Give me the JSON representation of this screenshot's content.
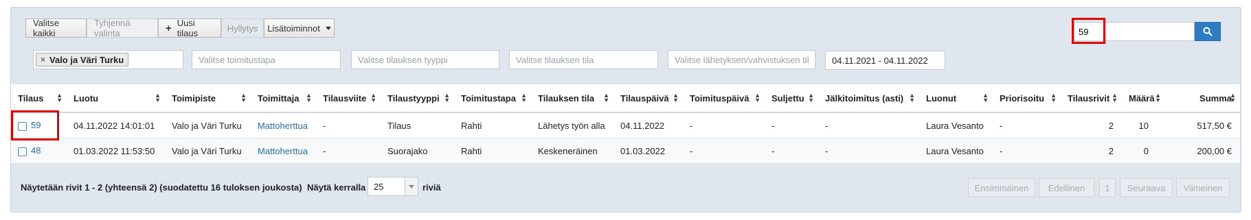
{
  "toolbar": {
    "select_all": "Valitse kaikki",
    "clear_selection": "Tyhjennä valinta",
    "new_order_icon": "plus-icon",
    "new_order": "Uusi tilaus",
    "approval": "Hyllytys",
    "more_actions": "Lisätoiminnot"
  },
  "search": {
    "value": "59",
    "icon": "search-icon"
  },
  "filters": {
    "store_tag": "Valo ja Väri Turku",
    "delivery_method_placeholder": "Valitse toimitustapa",
    "order_type_placeholder": "Valitse tilauksen tyyppi",
    "order_status_placeholder": "Valitse tilauksen tila",
    "shipment_status_placeholder": "Valitse lähetyksen/vahvistuksen tila",
    "date_range": "04.11.2021 - 04.11.2022"
  },
  "table": {
    "columns": [
      "Tilaus",
      "Luotu",
      "Toimipiste",
      "Toimittaja",
      "Tilausviite",
      "Tilaustyyppi",
      "Toimitustapa",
      "Tilauksen tila",
      "Tilauspäivä",
      "Toimituspäivä",
      "Suljettu",
      "Jälkitoimitus (asti)",
      "Luonut",
      "Priorisoitu",
      "Tilausrivit",
      "Määrä",
      "Summa"
    ],
    "rows": [
      {
        "order": "59",
        "created": "04.11.2022 14:01:01",
        "store": "Valo ja Väri Turku",
        "supplier": "Mattoherttua",
        "reference": "-",
        "type": "Tilaus",
        "delivery": "Rahti",
        "status": "Lähetys työn alla",
        "order_date": "04.11.2022",
        "delivery_date": "-",
        "closed": "-",
        "backorder": "-",
        "created_by": "Laura Vesanto",
        "prioritized": "-",
        "lines": "2",
        "quantity": "10",
        "sum": "517,50 €"
      },
      {
        "order": "48",
        "created": "01.03.2022 11:53:50",
        "store": "Valo ja Väri Turku",
        "supplier": "Mattoherttua",
        "reference": "-",
        "type": "Suorajako",
        "delivery": "Rahti",
        "status": "Keskeneräinen",
        "order_date": "01.03.2022",
        "delivery_date": "-",
        "closed": "-",
        "backorder": "-",
        "created_by": "Laura Vesanto",
        "prioritized": "-",
        "lines": "2",
        "quantity": "0",
        "sum": "200,00 €"
      }
    ]
  },
  "footer": {
    "summary": "Näytetään rivit 1 - 2 (yhteensä 2) (suodatettu 16 tuloksen joukosta)",
    "show_label": "Näytä kerralla",
    "page_size": "25",
    "rows_label": "riviä"
  },
  "pagination": {
    "first": "Ensimmäinen",
    "previous": "Edellinen",
    "page": "1",
    "next": "Seuraava",
    "last": "Viimeinen"
  }
}
